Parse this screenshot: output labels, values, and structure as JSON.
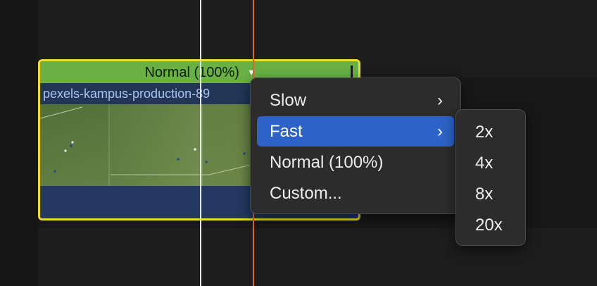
{
  "clip": {
    "speed_label": "Normal (100%)",
    "speed_chevron": "▾",
    "name": "pexels-kampus-production-89",
    "colors": {
      "border": "#f2dc2b",
      "header": "#69b145",
      "body": "#23385c"
    }
  },
  "playheads": {
    "skimmer_color": "#e6e6e6",
    "playhead_color": "#e2652a"
  },
  "speed_menu": {
    "items": [
      {
        "label": "Slow",
        "has_submenu": true,
        "arrow": "›"
      },
      {
        "label": "Fast",
        "has_submenu": true,
        "arrow": "›",
        "selected": true
      },
      {
        "label": "Normal (100%)",
        "has_submenu": false
      },
      {
        "label": "Custom...",
        "has_submenu": false
      }
    ],
    "highlight_color": "#2d63c8"
  },
  "fast_submenu": {
    "items": [
      {
        "label": "2x"
      },
      {
        "label": "4x"
      },
      {
        "label": "8x"
      },
      {
        "label": "20x"
      }
    ]
  }
}
